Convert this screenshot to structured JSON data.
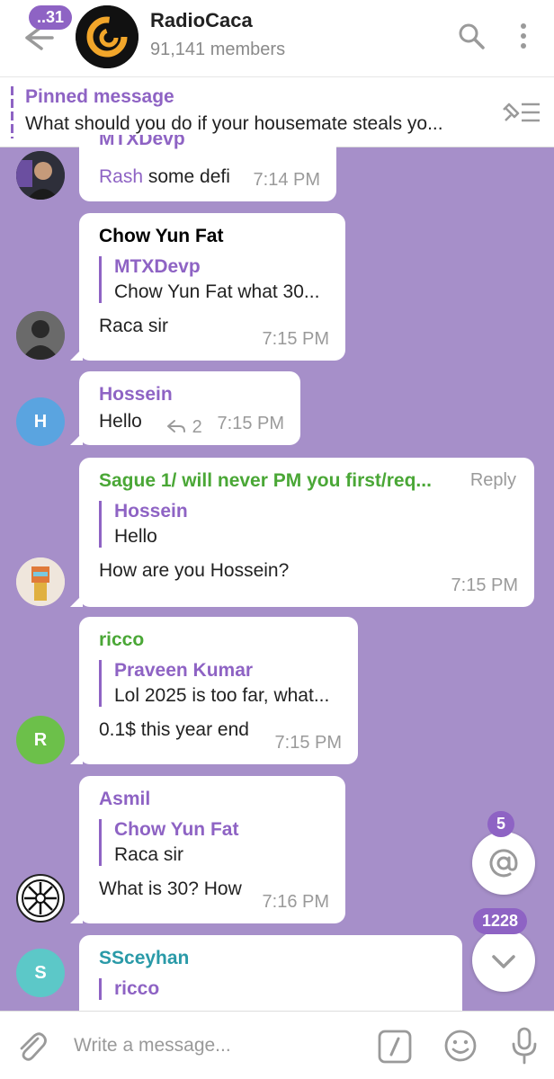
{
  "header": {
    "back_badge": "..31",
    "title": "RadioCaca",
    "subtitle": "91,141 members"
  },
  "pinned": {
    "title": "Pinned message",
    "text": "What should you do if your housemate steals yo..."
  },
  "messages": [
    {
      "sender": "MTXDevp",
      "sender_color": "#8e63c4",
      "text_lead": "Rash",
      "text": "some defi",
      "time": "7:14 PM"
    },
    {
      "sender": "Chow Yun Fat",
      "sender_color": "#8e63c4",
      "quote_name": "MTXDevp",
      "quote_text": "Chow Yun Fat what 30...",
      "text": "Raca sir",
      "time": "7:15 PM"
    },
    {
      "sender": "Hossein",
      "sender_color": "#8e63c4",
      "avatar_letter": "H",
      "avatar_color": "#5aa4e0",
      "text": "Hello",
      "reply_count": "2",
      "time": "7:15 PM"
    },
    {
      "sender": "Sague 1/ will never PM you first/req...",
      "sender_color": "#4aa736",
      "reply_label": "Reply",
      "quote_name": "Hossein",
      "quote_text": "Hello",
      "text": "How are you Hossein?",
      "time": "7:15 PM"
    },
    {
      "sender": "ricco",
      "sender_color": "#4aa736",
      "avatar_letter": "R",
      "avatar_color": "#6cc04a",
      "quote_name": "Praveen Kumar",
      "quote_text": "Lol 2025 is too far, what...",
      "text": "0.1$ this year end",
      "time": "7:15 PM"
    },
    {
      "sender": "Asmil",
      "sender_color": "#8e63c4",
      "quote_name": "Chow Yun Fat",
      "quote_text": "Raca sir",
      "text": "What is 30? How",
      "time": "7:16 PM"
    },
    {
      "sender": "SSceyhan",
      "sender_color": "#2a9aa8",
      "avatar_letter": "S",
      "avatar_color": "#5cc8c8",
      "quote_name": "ricco"
    }
  ],
  "mentions_badge": "5",
  "unread_badge": "1228",
  "input": {
    "placeholder": "Write a message..."
  },
  "colors": {
    "accent": "#8e63c4",
    "chat_background": "#a68fc9"
  }
}
